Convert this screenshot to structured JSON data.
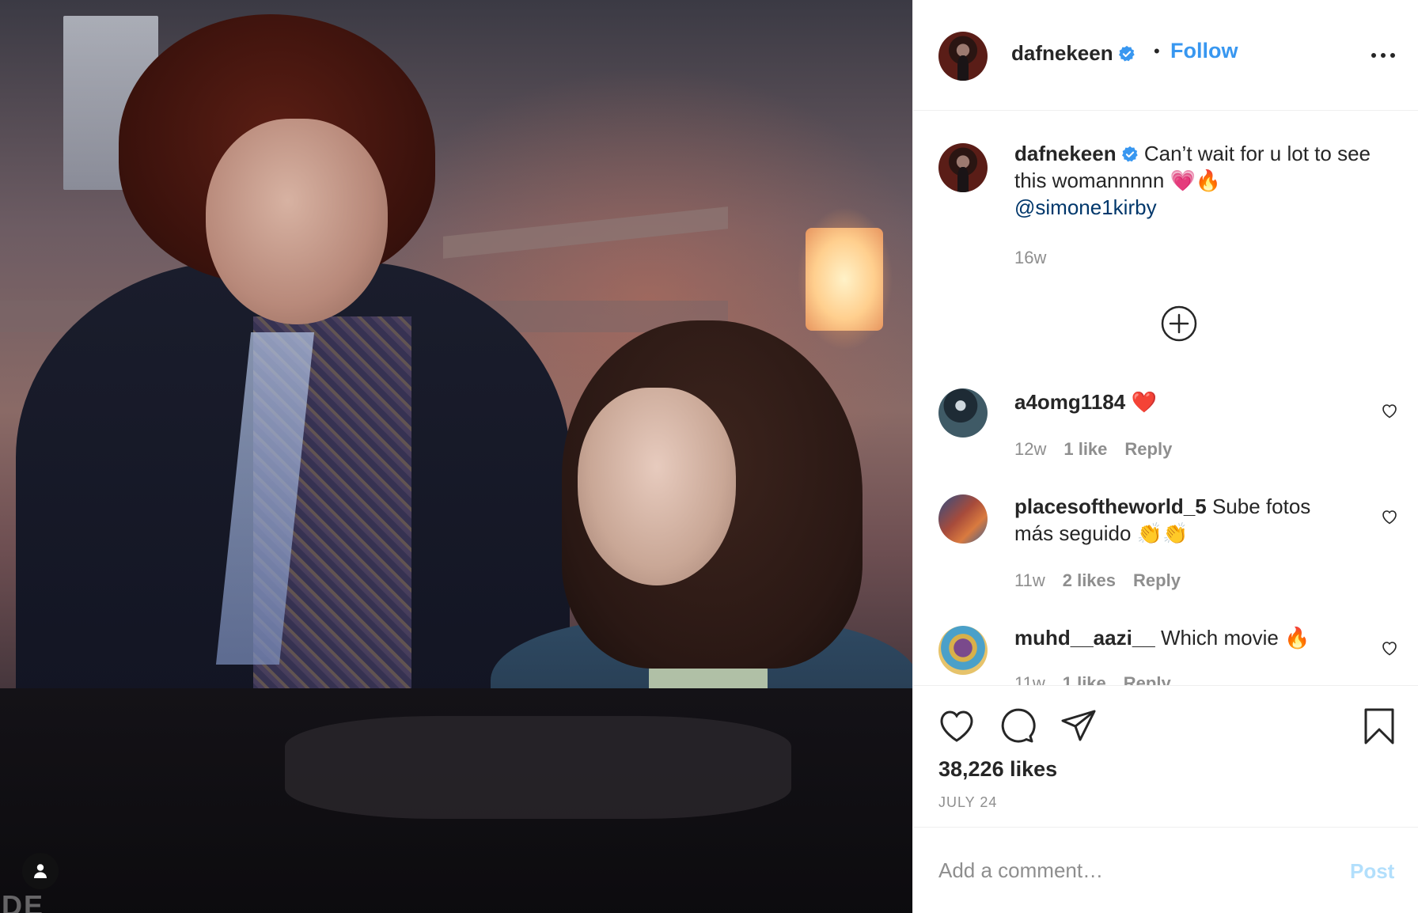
{
  "post": {
    "username": "dafnekeen",
    "follow_label": "Follow",
    "separator": "•",
    "caption_username": "dafnekeen",
    "caption_text": "Can’t wait for u lot to see this womannnnn 💗🔥",
    "caption_mention": "@simone1kirby",
    "caption_time": "16w",
    "likes": "38,226 likes",
    "date": "JULY 24"
  },
  "comments": [
    {
      "username": "a4omg1184",
      "text": "❤️",
      "time": "12w",
      "likes": "1 like",
      "reply": "Reply"
    },
    {
      "username": "placesoftheworld_5",
      "text": "Sube fotos más seguido 👏👏",
      "time": "11w",
      "likes": "2 likes",
      "reply": "Reply"
    },
    {
      "username": "muhd__aazi__",
      "text": "Which movie 🔥",
      "time": "11w",
      "likes": "1 like",
      "reply": "Reply"
    }
  ],
  "add_comment": {
    "placeholder": "Add a comment…",
    "post_label": "Post"
  },
  "colors": {
    "accent_blue": "#3897f0",
    "post_disabled": "#b2dffc",
    "muted_text": "#8e8e8e",
    "mention": "#00376b",
    "verified": "#3897f0"
  },
  "icons": {
    "verified": "verified-badge-icon",
    "more": "more-options-icon",
    "load_more": "load-more-comments-icon",
    "like": "heart-icon",
    "comment": "comment-icon",
    "share": "share-icon",
    "save": "bookmark-icon",
    "tag": "user-tag-icon"
  }
}
